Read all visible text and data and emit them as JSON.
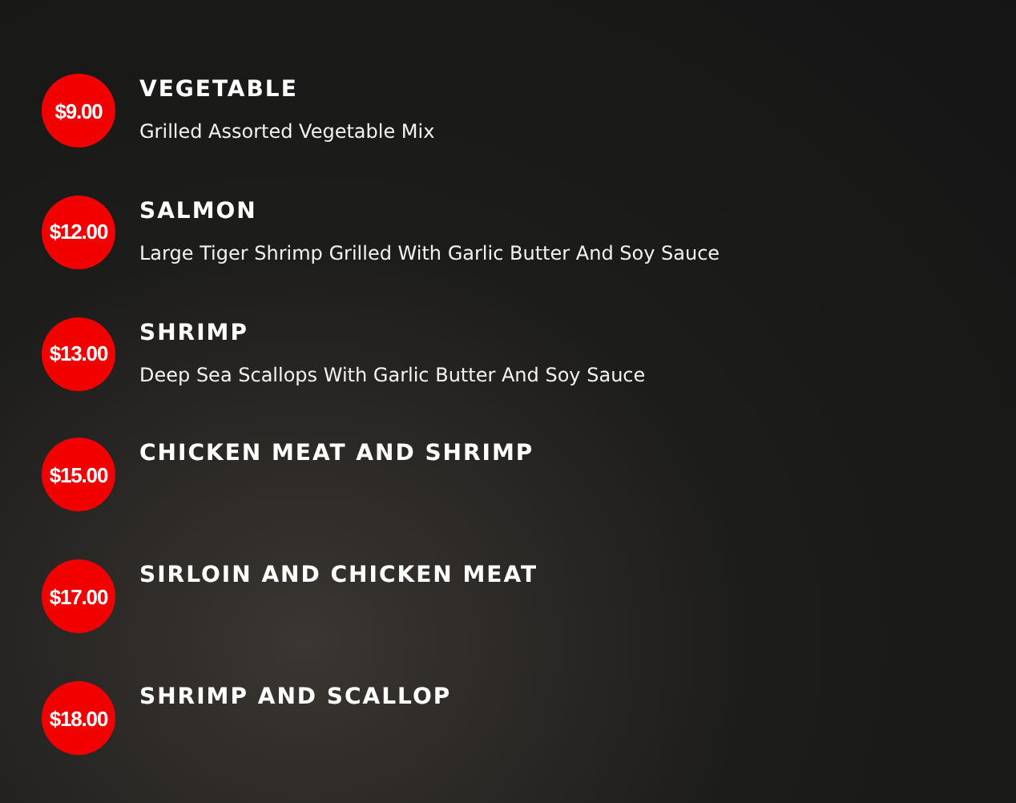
{
  "menu_items": [
    {
      "price": "$9.00",
      "name": "VEGETABLE",
      "description": "Grilled Assorted Vegetable Mix"
    },
    {
      "price": "$12.00",
      "name": "SALMON",
      "description": "Large Tiger Shrimp Grilled With Garlic Butter And Soy Sauce"
    },
    {
      "price": "$13.00",
      "name": "SHRIMP",
      "description": "Deep Sea Scallops With Garlic Butter And Soy Sauce"
    },
    {
      "price": "$15.00",
      "name": "CHICKEN MEAT AND SHRIMP"
    },
    {
      "price": "$17.00",
      "name": "SIRLOIN AND CHICKEN MEAT"
    },
    {
      "price": "$18.00",
      "name": "SHRIMP AND SCALLOP"
    }
  ]
}
